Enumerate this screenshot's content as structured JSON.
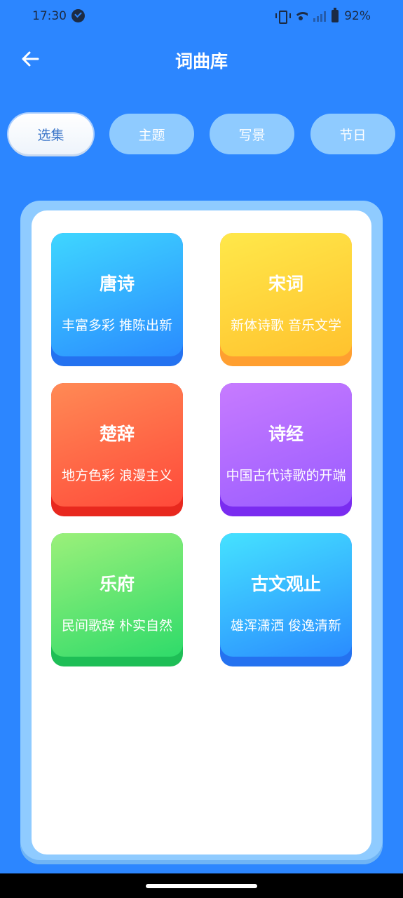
{
  "status_bar": {
    "time": "17:30",
    "battery": "92%",
    "icons": [
      "check-circle-icon",
      "vibrate-icon",
      "wifi-icon",
      "signal-icon",
      "battery-icon"
    ]
  },
  "header": {
    "title": "词曲库",
    "back_icon": "arrow-left-icon"
  },
  "tabs": [
    {
      "label": "选集",
      "active": true
    },
    {
      "label": "主题",
      "active": false
    },
    {
      "label": "写景",
      "active": false
    },
    {
      "label": "节日",
      "active": false
    }
  ],
  "cards": [
    {
      "title": "唐诗",
      "subtitle": "丰富多彩 推陈出新",
      "colors": [
        "#3FD6FF",
        "#2A8CFF",
        "#2472F0"
      ]
    },
    {
      "title": "宋词",
      "subtitle": "新体诗歌 音乐文学",
      "colors": [
        "#FFE84A",
        "#FFC22E",
        "#FF9F30"
      ]
    },
    {
      "title": "楚辞",
      "subtitle": "地方色彩 浪漫主义",
      "colors": [
        "#FF8A55",
        "#FF4A3A",
        "#E8281E"
      ]
    },
    {
      "title": "诗经",
      "subtitle": "中国古代诗歌的开端",
      "colors": [
        "#C77BFF",
        "#9A5CFF",
        "#7A2CF0"
      ]
    },
    {
      "title": "乐府",
      "subtitle": "民间歌辞 朴实自然",
      "colors": [
        "#9BF07A",
        "#2FDB6A",
        "#1EBE56"
      ]
    },
    {
      "title": "古文观止",
      "subtitle": "雄浑潇洒 俊逸清新",
      "colors": [
        "#45E2FF",
        "#2A8CFF",
        "#2472F0"
      ]
    }
  ],
  "theme": {
    "background": "#2C86FF",
    "panel_border": "#8FCBFF",
    "tab_inactive": "#8FCBFF",
    "tab_active_text": "#3C76C9"
  }
}
